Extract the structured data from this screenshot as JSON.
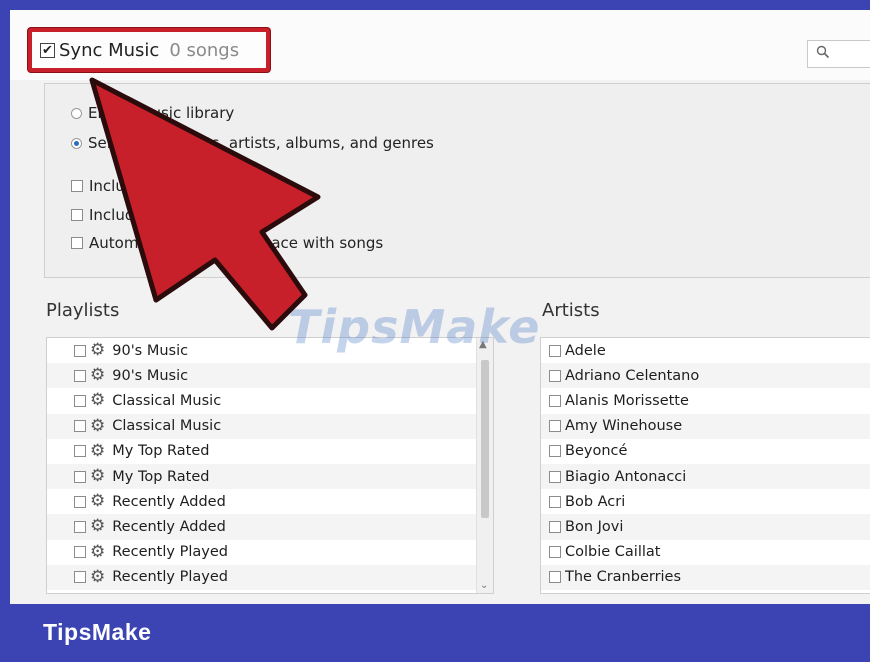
{
  "sync": {
    "checked": true,
    "label": "Sync Music",
    "count": "0 songs"
  },
  "search": {
    "icon": "search-icon"
  },
  "options": [
    {
      "type": "radio",
      "checked": false,
      "label": "Entire music library"
    },
    {
      "type": "radio",
      "checked": true,
      "label": "Selected playlists, artists, albums, and genres"
    },
    {
      "type": "checkbox",
      "checked": false,
      "label": "Include music videos"
    },
    {
      "type": "checkbox",
      "checked": false,
      "label": "Include voice memos"
    },
    {
      "type": "checkbox",
      "checked": false,
      "label": "Automatically fill free space with songs"
    }
  ],
  "playlists": {
    "title": "Playlists",
    "items": [
      "90's Music",
      "90's Music",
      "Classical Music",
      "Classical Music",
      "My Top Rated",
      "My Top Rated",
      "Recently Added",
      "Recently Added",
      "Recently Played",
      "Recently Played"
    ]
  },
  "artists": {
    "title": "Artists",
    "items": [
      "Adele",
      "Adriano Celentano",
      "Alanis Morissette",
      "Amy Winehouse",
      "Beyoncé",
      "Biagio Antonacci",
      "Bob Acri",
      "Bon Jovi",
      "Colbie Caillat",
      "The Cranberries"
    ]
  },
  "watermark": "TipsMake",
  "footer": {
    "brand": "TipsMake"
  },
  "colors": {
    "highlight": "#c8202a",
    "footer": "#3c44b4",
    "arrow": "#c8202a"
  }
}
